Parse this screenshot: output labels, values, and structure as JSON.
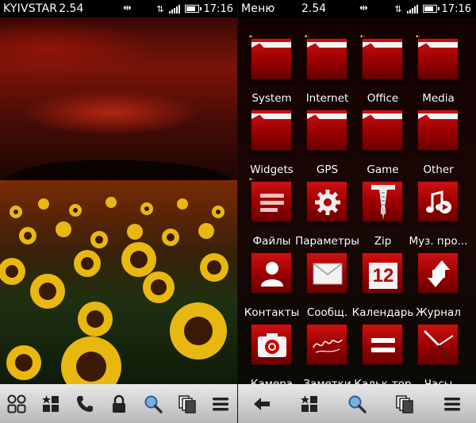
{
  "left_screen": {
    "status": {
      "operator": "KYIVSTAR",
      "version": "2.54",
      "time": "17:16",
      "battery_level": 0.85
    },
    "dock": {
      "icons": [
        "apps-grid-icon",
        "favorites-icon",
        "phone-icon",
        "lock-icon",
        "search-icon",
        "multitask-icon",
        "menu-icon"
      ]
    }
  },
  "right_screen": {
    "status": {
      "title": "Меню",
      "version": "2.54",
      "time": "17:16",
      "battery_level": 0.85
    },
    "menu": {
      "rows": [
        {
          "items": [
            {
              "label": "System",
              "icon": "folder-icon"
            },
            {
              "label": "Internet",
              "icon": "folder-icon"
            },
            {
              "label": "Office",
              "icon": "folder-icon"
            },
            {
              "label": "Media",
              "icon": "folder-icon"
            }
          ]
        },
        {
          "items": [
            {
              "label": "Widgets",
              "icon": "folder-icon"
            },
            {
              "label": "GPS",
              "icon": "folder-icon"
            },
            {
              "label": "Game",
              "icon": "folder-icon"
            },
            {
              "label": "Other",
              "icon": "folder-icon"
            }
          ]
        },
        {
          "items": [
            {
              "label": "Файлы",
              "icon": "files-icon"
            },
            {
              "label": "Параметры",
              "icon": "settings-gear-icon"
            },
            {
              "label": "Zip",
              "icon": "zip-icon"
            },
            {
              "label": "Муз. про...",
              "icon": "music-icon"
            }
          ]
        },
        {
          "items": [
            {
              "label": "Контакты",
              "icon": "contacts-icon"
            },
            {
              "label": "Сообщ.",
              "icon": "messages-envelope-icon"
            },
            {
              "label": "Календарь",
              "icon": "calendar-icon",
              "badge": "12"
            },
            {
              "label": "Журнал",
              "icon": "log-arrows-icon"
            }
          ]
        },
        {
          "items": [
            {
              "label": "Камера",
              "icon": "camera-icon"
            },
            {
              "label": "Заметки",
              "icon": "notes-icon"
            },
            {
              "label": "Кальк-тор",
              "icon": "calculator-icon"
            },
            {
              "label": "Часы",
              "icon": "clock-icon"
            }
          ]
        }
      ]
    },
    "dock": {
      "icons": [
        "back-arrow-icon",
        "favorites-icon",
        "search-icon",
        "multitask-icon",
        "menu-icon"
      ]
    }
  }
}
